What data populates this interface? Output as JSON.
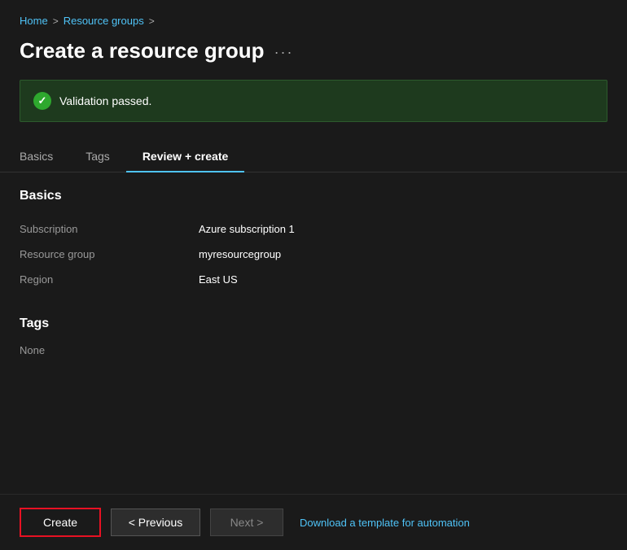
{
  "breadcrumb": {
    "home": "Home",
    "separator1": ">",
    "resource_groups": "Resource groups",
    "separator2": ">"
  },
  "page": {
    "title": "Create a resource group",
    "more_options": "···"
  },
  "validation": {
    "text": "Validation passed.",
    "icon_label": "check"
  },
  "tabs": [
    {
      "label": "Basics",
      "active": false
    },
    {
      "label": "Tags",
      "active": false
    },
    {
      "label": "Review + create",
      "active": true
    }
  ],
  "sections": {
    "basics": {
      "title": "Basics",
      "rows": [
        {
          "label": "Subscription",
          "value": "Azure subscription 1"
        },
        {
          "label": "Resource group",
          "value": "myresourcegroup"
        },
        {
          "label": "Region",
          "value": "East US"
        }
      ]
    },
    "tags": {
      "title": "Tags",
      "value": "None"
    }
  },
  "footer": {
    "create_label": "Create",
    "previous_label": "< Previous",
    "next_label": "Next >",
    "automation_link": "Download a template for automation"
  }
}
